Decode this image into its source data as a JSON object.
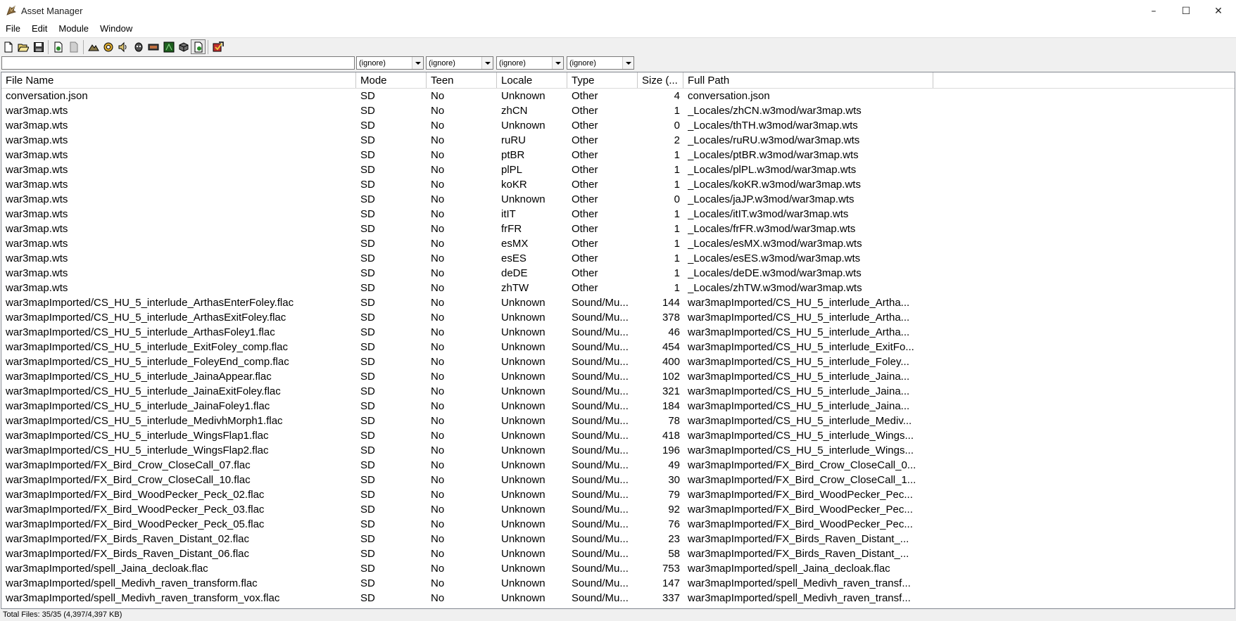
{
  "window": {
    "title": "Asset Manager",
    "minimize": "–",
    "maximize": "☐",
    "close": "✕"
  },
  "menu": [
    "File",
    "Edit",
    "Module",
    "Window"
  ],
  "toolbar": [
    {
      "name": "new-icon"
    },
    {
      "name": "open-icon"
    },
    {
      "name": "save-icon"
    },
    {
      "name": "import-icon"
    },
    {
      "name": "document-icon"
    },
    {
      "name": "model-icon"
    },
    {
      "name": "object-icon"
    },
    {
      "name": "sound-icon"
    },
    {
      "name": "ai-icon"
    },
    {
      "name": "trigger-icon"
    },
    {
      "name": "terrain-icon"
    },
    {
      "name": "unit-icon"
    },
    {
      "name": "asset-manager-icon",
      "pressed": true
    },
    {
      "name": "test-map-icon"
    }
  ],
  "filters": {
    "search_value": "",
    "combos": [
      "(ignore)",
      "(ignore)",
      "(ignore)",
      "(ignore)"
    ]
  },
  "columns": [
    "File Name",
    "Mode",
    "Teen",
    "Locale",
    "Type",
    "Size (...",
    "Full Path"
  ],
  "rows": [
    [
      "conversation.json",
      "SD",
      "No",
      "Unknown",
      "Other",
      "4",
      "conversation.json"
    ],
    [
      "war3map.wts",
      "SD",
      "No",
      "zhCN",
      "Other",
      "1",
      "_Locales/zhCN.w3mod/war3map.wts"
    ],
    [
      "war3map.wts",
      "SD",
      "No",
      "Unknown",
      "Other",
      "0",
      "_Locales/thTH.w3mod/war3map.wts"
    ],
    [
      "war3map.wts",
      "SD",
      "No",
      "ruRU",
      "Other",
      "2",
      "_Locales/ruRU.w3mod/war3map.wts"
    ],
    [
      "war3map.wts",
      "SD",
      "No",
      "ptBR",
      "Other",
      "1",
      "_Locales/ptBR.w3mod/war3map.wts"
    ],
    [
      "war3map.wts",
      "SD",
      "No",
      "plPL",
      "Other",
      "1",
      "_Locales/plPL.w3mod/war3map.wts"
    ],
    [
      "war3map.wts",
      "SD",
      "No",
      "koKR",
      "Other",
      "1",
      "_Locales/koKR.w3mod/war3map.wts"
    ],
    [
      "war3map.wts",
      "SD",
      "No",
      "Unknown",
      "Other",
      "0",
      "_Locales/jaJP.w3mod/war3map.wts"
    ],
    [
      "war3map.wts",
      "SD",
      "No",
      "itIT",
      "Other",
      "1",
      "_Locales/itIT.w3mod/war3map.wts"
    ],
    [
      "war3map.wts",
      "SD",
      "No",
      "frFR",
      "Other",
      "1",
      "_Locales/frFR.w3mod/war3map.wts"
    ],
    [
      "war3map.wts",
      "SD",
      "No",
      "esMX",
      "Other",
      "1",
      "_Locales/esMX.w3mod/war3map.wts"
    ],
    [
      "war3map.wts",
      "SD",
      "No",
      "esES",
      "Other",
      "1",
      "_Locales/esES.w3mod/war3map.wts"
    ],
    [
      "war3map.wts",
      "SD",
      "No",
      "deDE",
      "Other",
      "1",
      "_Locales/deDE.w3mod/war3map.wts"
    ],
    [
      "war3map.wts",
      "SD",
      "No",
      "zhTW",
      "Other",
      "1",
      "_Locales/zhTW.w3mod/war3map.wts"
    ],
    [
      "war3mapImported/CS_HU_5_interlude_ArthasEnterFoley.flac",
      "SD",
      "No",
      "Unknown",
      "Sound/Mu...",
      "144",
      "war3mapImported/CS_HU_5_interlude_Artha..."
    ],
    [
      "war3mapImported/CS_HU_5_interlude_ArthasExitFoley.flac",
      "SD",
      "No",
      "Unknown",
      "Sound/Mu...",
      "378",
      "war3mapImported/CS_HU_5_interlude_Artha..."
    ],
    [
      "war3mapImported/CS_HU_5_interlude_ArthasFoley1.flac",
      "SD",
      "No",
      "Unknown",
      "Sound/Mu...",
      "46",
      "war3mapImported/CS_HU_5_interlude_Artha..."
    ],
    [
      "war3mapImported/CS_HU_5_interlude_ExitFoley_comp.flac",
      "SD",
      "No",
      "Unknown",
      "Sound/Mu...",
      "454",
      "war3mapImported/CS_HU_5_interlude_ExitFo..."
    ],
    [
      "war3mapImported/CS_HU_5_interlude_FoleyEnd_comp.flac",
      "SD",
      "No",
      "Unknown",
      "Sound/Mu...",
      "400",
      "war3mapImported/CS_HU_5_interlude_Foley..."
    ],
    [
      "war3mapImported/CS_HU_5_interlude_JainaAppear.flac",
      "SD",
      "No",
      "Unknown",
      "Sound/Mu...",
      "102",
      "war3mapImported/CS_HU_5_interlude_Jaina..."
    ],
    [
      "war3mapImported/CS_HU_5_interlude_JainaExitFoley.flac",
      "SD",
      "No",
      "Unknown",
      "Sound/Mu...",
      "321",
      "war3mapImported/CS_HU_5_interlude_Jaina..."
    ],
    [
      "war3mapImported/CS_HU_5_interlude_JainaFoley1.flac",
      "SD",
      "No",
      "Unknown",
      "Sound/Mu...",
      "184",
      "war3mapImported/CS_HU_5_interlude_Jaina..."
    ],
    [
      "war3mapImported/CS_HU_5_interlude_MedivhMorph1.flac",
      "SD",
      "No",
      "Unknown",
      "Sound/Mu...",
      "78",
      "war3mapImported/CS_HU_5_interlude_Mediv..."
    ],
    [
      "war3mapImported/CS_HU_5_interlude_WingsFlap1.flac",
      "SD",
      "No",
      "Unknown",
      "Sound/Mu...",
      "418",
      "war3mapImported/CS_HU_5_interlude_Wings..."
    ],
    [
      "war3mapImported/CS_HU_5_interlude_WingsFlap2.flac",
      "SD",
      "No",
      "Unknown",
      "Sound/Mu...",
      "196",
      "war3mapImported/CS_HU_5_interlude_Wings..."
    ],
    [
      "war3mapImported/FX_Bird_Crow_CloseCall_07.flac",
      "SD",
      "No",
      "Unknown",
      "Sound/Mu...",
      "49",
      "war3mapImported/FX_Bird_Crow_CloseCall_0..."
    ],
    [
      "war3mapImported/FX_Bird_Crow_CloseCall_10.flac",
      "SD",
      "No",
      "Unknown",
      "Sound/Mu...",
      "30",
      "war3mapImported/FX_Bird_Crow_CloseCall_1..."
    ],
    [
      "war3mapImported/FX_Bird_WoodPecker_Peck_02.flac",
      "SD",
      "No",
      "Unknown",
      "Sound/Mu...",
      "79",
      "war3mapImported/FX_Bird_WoodPecker_Pec..."
    ],
    [
      "war3mapImported/FX_Bird_WoodPecker_Peck_03.flac",
      "SD",
      "No",
      "Unknown",
      "Sound/Mu...",
      "92",
      "war3mapImported/FX_Bird_WoodPecker_Pec..."
    ],
    [
      "war3mapImported/FX_Bird_WoodPecker_Peck_05.flac",
      "SD",
      "No",
      "Unknown",
      "Sound/Mu...",
      "76",
      "war3mapImported/FX_Bird_WoodPecker_Pec..."
    ],
    [
      "war3mapImported/FX_Birds_Raven_Distant_02.flac",
      "SD",
      "No",
      "Unknown",
      "Sound/Mu...",
      "23",
      "war3mapImported/FX_Birds_Raven_Distant_..."
    ],
    [
      "war3mapImported/FX_Birds_Raven_Distant_06.flac",
      "SD",
      "No",
      "Unknown",
      "Sound/Mu...",
      "58",
      "war3mapImported/FX_Birds_Raven_Distant_..."
    ],
    [
      "war3mapImported/spell_Jaina_decloak.flac",
      "SD",
      "No",
      "Unknown",
      "Sound/Mu...",
      "753",
      "war3mapImported/spell_Jaina_decloak.flac"
    ],
    [
      "war3mapImported/spell_Medivh_raven_transform.flac",
      "SD",
      "No",
      "Unknown",
      "Sound/Mu...",
      "147",
      "war3mapImported/spell_Medivh_raven_transf..."
    ],
    [
      "war3mapImported/spell_Medivh_raven_transform_vox.flac",
      "SD",
      "No",
      "Unknown",
      "Sound/Mu...",
      "337",
      "war3mapImported/spell_Medivh_raven_transf..."
    ]
  ],
  "status": "Total Files: 35/35 (4,397/4,397 KB)"
}
